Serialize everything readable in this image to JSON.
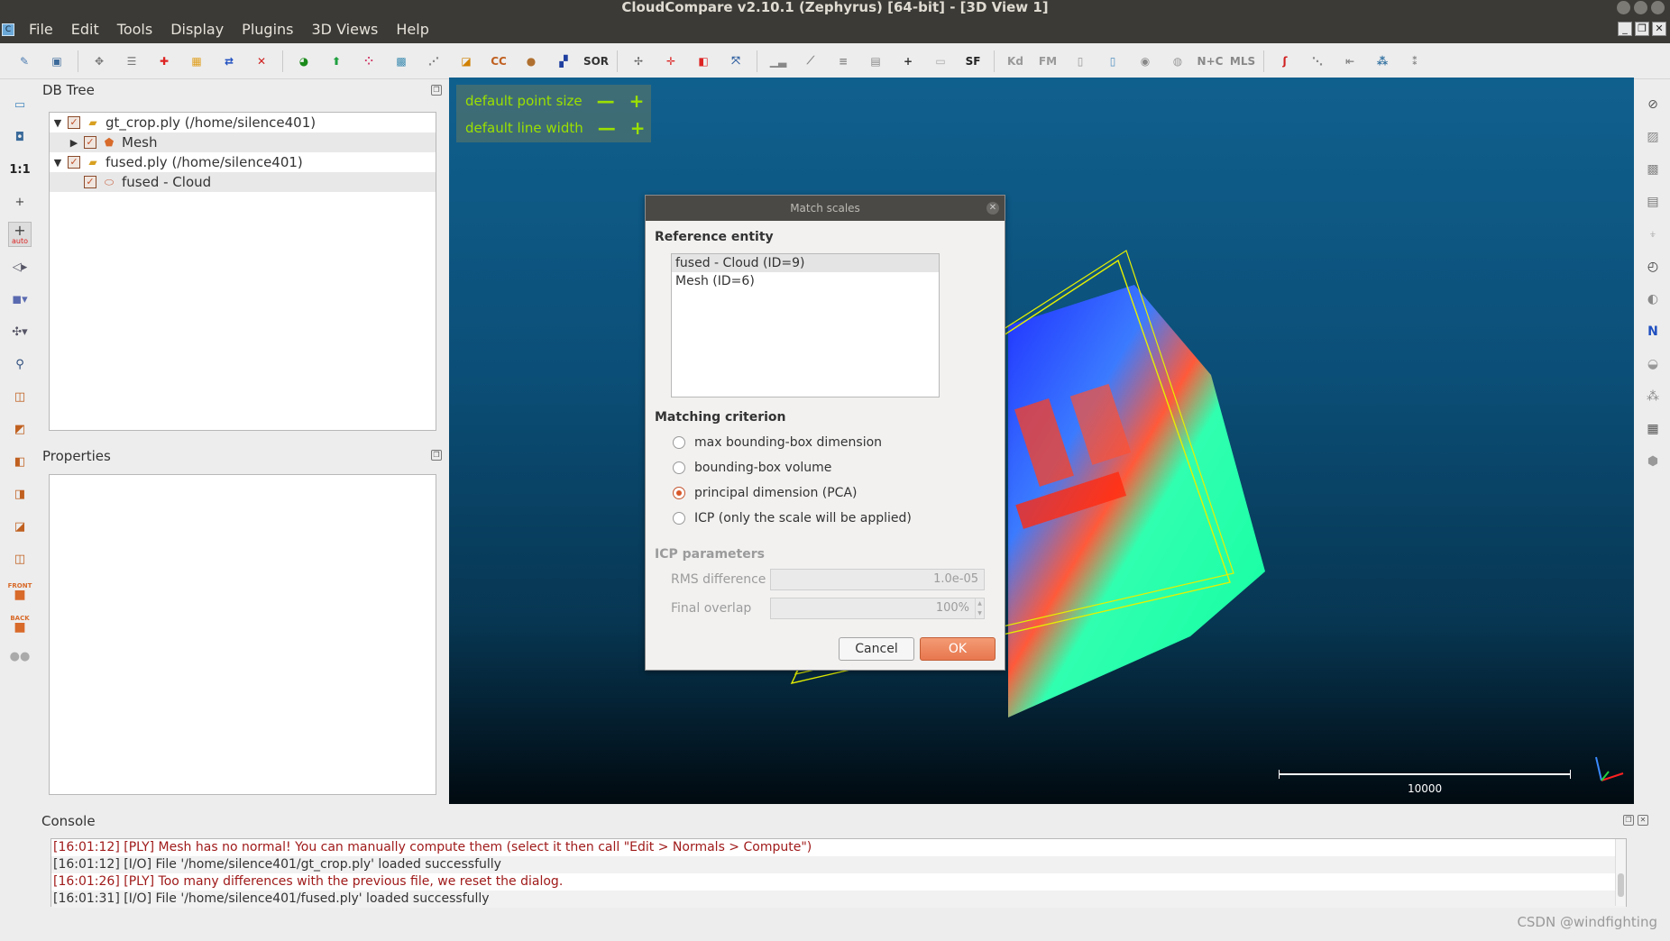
{
  "window": {
    "title": "CloudCompare v2.10.1 (Zephyrus) [64-bit] - [3D View 1]"
  },
  "menu": [
    "File",
    "Edit",
    "Tools",
    "Display",
    "Plugins",
    "3D Views",
    "Help"
  ],
  "toolbar": {
    "sor_label": "SOR",
    "sf_label": "SF",
    "cc_label": "CC",
    "kd_label": "Kd",
    "fm_label": "FM",
    "nc_label": "N+C",
    "mls_label": "MLS"
  },
  "db_tree": {
    "title": "DB Tree",
    "items": [
      {
        "label": "gt_crop.ply (/home/silence401)"
      },
      {
        "label": "Mesh"
      },
      {
        "label": "fused.ply (/home/silence401)"
      },
      {
        "label": "fused - Cloud"
      }
    ]
  },
  "properties": {
    "title": "Properties"
  },
  "view": {
    "hud": {
      "point_size_label": "default point size",
      "line_width_label": "default line width",
      "minus": "—",
      "plus": "+"
    },
    "scale_label": "10000"
  },
  "left_tools": {
    "one_to_one": "1:1",
    "front_label": "FRONT",
    "back_label": "BACK",
    "auto_label": "auto"
  },
  "right_tools": {
    "n_label": "N"
  },
  "dialog": {
    "title": "Match scales",
    "reference_heading": "Reference entity",
    "reference_items": [
      "fused - Cloud (ID=9)",
      "Mesh (ID=6)"
    ],
    "criterion_heading": "Matching criterion",
    "criteria": [
      {
        "label": "max bounding-box dimension",
        "checked": false
      },
      {
        "label": "bounding-box volume",
        "checked": false
      },
      {
        "label": "principal dimension (PCA)",
        "checked": true
      },
      {
        "label": "ICP (only the scale will be applied)",
        "checked": false
      }
    ],
    "icp_heading": "ICP parameters",
    "rms_label": "RMS difference",
    "rms_value": "1.0e-05",
    "overlap_label": "Final overlap",
    "overlap_value": "100%",
    "cancel_label": "Cancel",
    "ok_label": "OK"
  },
  "console": {
    "title": "Console",
    "lines": [
      {
        "text": "[16:01:12] [PLY] Mesh has no normal! You can manually compute them (select it then call \"Edit > Normals > Compute\")",
        "level": "error"
      },
      {
        "text": "[16:01:12] [I/O] File '/home/silence401/gt_crop.ply' loaded successfully",
        "level": "info"
      },
      {
        "text": "[16:01:26] [PLY] Too many differences with the previous file, we reset the dialog.",
        "level": "error"
      },
      {
        "text": "[16:01:31] [I/O] File '/home/silence401/fused.ply' loaded successfully",
        "level": "info"
      }
    ]
  },
  "watermark": "CSDN @windfighting",
  "colors": {
    "accent": "#e8774f",
    "hud_text": "#9be000",
    "error_text": "#a01a1a",
    "titlebar": "#3b3a36"
  }
}
